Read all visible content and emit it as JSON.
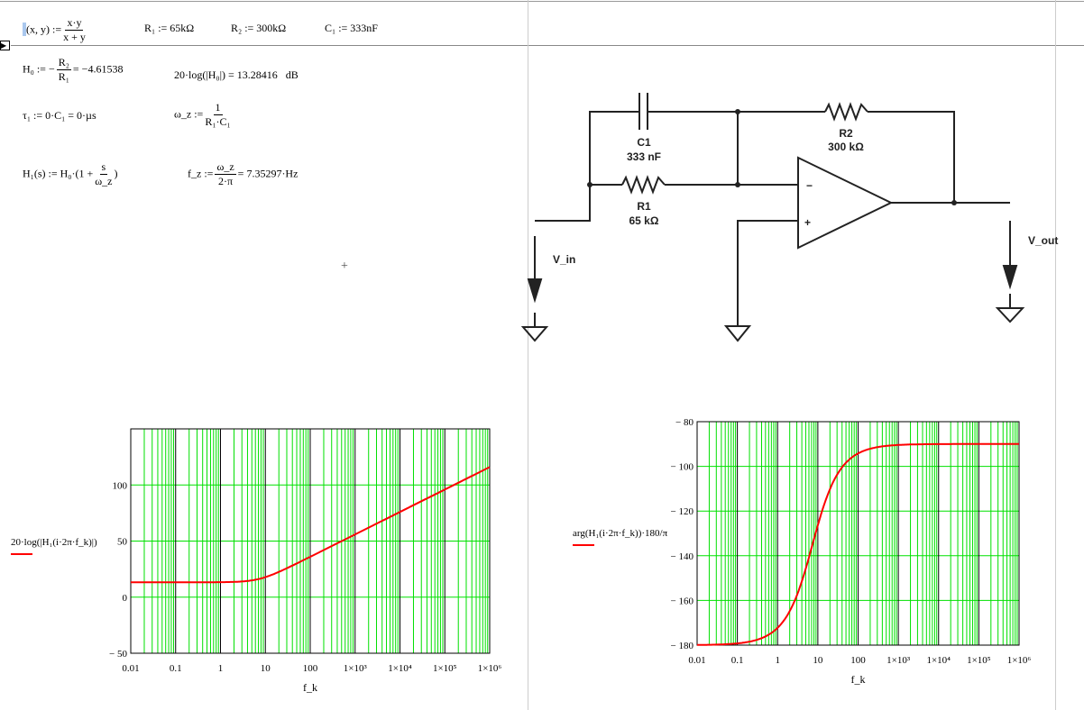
{
  "worksheet": {
    "par_def": {
      "lhs": "(x, y) :=",
      "num": "x·y",
      "den": "x + y"
    },
    "r1_def": "R₁ := 65kΩ",
    "r2_def": "R₂ := 300kΩ",
    "c1_def": "C₁ := 333nF",
    "h0": {
      "lhs": "H₀ := −",
      "num": "R₂",
      "den": "R₁",
      "result": "= −4.61538"
    },
    "h0_db": {
      "expr": "20·log(|H₀|) = 13.28416",
      "unit": "dB"
    },
    "tau1": "τ₁ := 0·C₁ = 0·µs",
    "wz": {
      "lhs": "ω_z :=",
      "num": "1",
      "den": "R₁·C₁"
    },
    "h1": {
      "lhs": "H₁(s) := H₀·(1 +",
      "num": "s",
      "den": "ω_z",
      "rhs": ")"
    },
    "fz": {
      "lhs": "f_z :=",
      "num": "ω_z",
      "den": "2·π",
      "result": "= 7.35297·Hz"
    },
    "cursor": "+"
  },
  "circuit": {
    "c1_name": "C1",
    "c1_value": "333 nF",
    "r1_name": "R1",
    "r1_value": "65 kΩ",
    "r2_name": "R2",
    "r2_value": "300 kΩ",
    "vin": "V_in",
    "vout": "V_out",
    "minus": "−",
    "plus": "+"
  },
  "chart_data": [
    {
      "type": "line",
      "title": "",
      "ylabel": "20·log(|H₁(i·2π·f_k)|)",
      "xlabel": "f_k",
      "xscale": "log",
      "xlim": [
        0.01,
        1000000
      ],
      "ylim": [
        -50,
        150
      ],
      "xticks": [
        "0.01",
        "0.1",
        "1",
        "10",
        "100",
        "1×10³",
        "1×10⁴",
        "1×10⁵",
        "1×10⁶"
      ],
      "yticks": [
        {
          "v": -50,
          "l": "− 50"
        },
        {
          "v": 0,
          "l": "0"
        },
        {
          "v": 50,
          "l": "50"
        },
        {
          "v": 100,
          "l": "100"
        }
      ],
      "grid": true,
      "series_color": "#ff0000",
      "grid_color": "#00e000",
      "x": [
        0.01,
        0.1,
        1,
        10,
        100,
        1000,
        10000,
        100000,
        1000000
      ],
      "y": [
        13.28,
        13.28,
        13.36,
        17.83,
        35.98,
        55.95,
        75.95,
        95.95,
        115.95
      ]
    },
    {
      "type": "line",
      "title": "",
      "ylabel": "arg(H₁(i·2π·f_k))·180/π",
      "xlabel": "f_k",
      "xscale": "log",
      "xlim": [
        0.01,
        1000000
      ],
      "ylim": [
        -180,
        -80
      ],
      "xticks": [
        "0.01",
        "0.1",
        "1",
        "10",
        "100",
        "1×10³",
        "1×10⁴",
        "1×10⁵",
        "1×10⁶"
      ],
      "yticks": [
        {
          "v": -180,
          "l": "− 180"
        },
        {
          "v": -160,
          "l": "− 160"
        },
        {
          "v": -140,
          "l": "− 140"
        },
        {
          "v": -120,
          "l": "− 120"
        },
        {
          "v": -100,
          "l": "− 100"
        },
        {
          "v": -80,
          "l": "− 80"
        }
      ],
      "grid": true,
      "series_color": "#ff0000",
      "grid_color": "#00e000",
      "x": [
        0.01,
        0.1,
        1,
        10,
        100,
        1000,
        10000,
        100000,
        1000000
      ],
      "y": [
        -179.92,
        -179.22,
        -172.26,
        -126.3,
        -94.2,
        -90.42,
        -90.04,
        -90.0,
        -90.0
      ]
    }
  ],
  "model": {
    "H0": -4.61538,
    "fz": 7.35297
  }
}
